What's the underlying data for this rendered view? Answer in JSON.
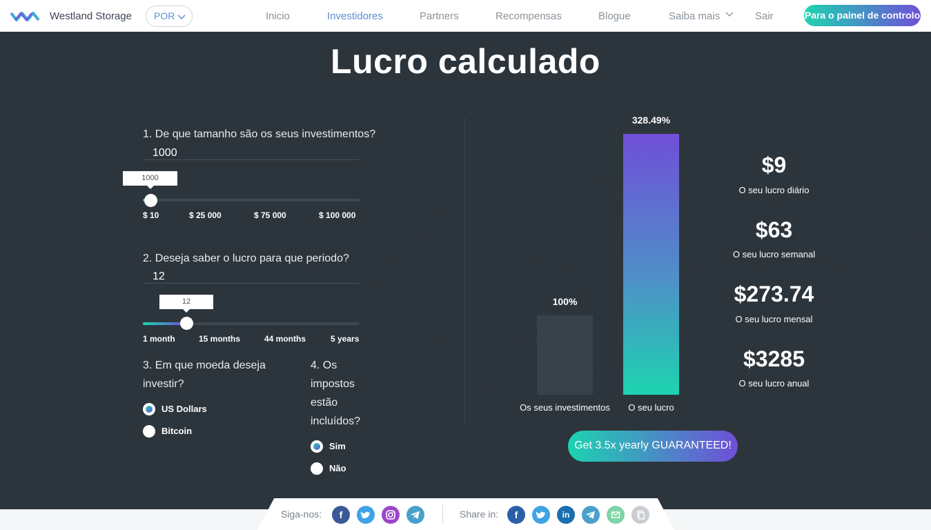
{
  "header": {
    "brand": "Westland Storage",
    "lang": "POR",
    "nav": [
      "Inicio",
      "Investidores",
      "Partners",
      "Recompensas",
      "Blogue",
      "Saiba mais",
      "Sair"
    ],
    "active_nav": "Investidores",
    "dashboard_button": "Para o painel de controlo"
  },
  "title": "Lucro calculado",
  "form": {
    "q1": "1. De que tamanho são os seus investimentos?",
    "amount_value": "1000",
    "amount_tooltip": "1000",
    "amount_slider_fraction": 0.0,
    "amount_ticks": [
      "$ 10",
      "$ 25 000",
      "$ 75 000",
      "$ 100 000"
    ],
    "q2": "2. Deseja saber o lucro para que periodo?",
    "period_value": "12",
    "period_tooltip": "12",
    "period_slider_fraction": 0.2,
    "period_ticks": [
      "1 month",
      "15 months",
      "44 months",
      "5 years"
    ],
    "q3": "3. Em que moeda deseja investir?",
    "currency_options": [
      "US Dollars",
      "Bitcoin"
    ],
    "currency_selected": "US Dollars",
    "q4": "4. Os impostos estão incluídos?",
    "tax_options": [
      "Sim",
      "Não"
    ],
    "tax_selected": "Sim"
  },
  "chart_data": {
    "type": "bar",
    "categories": [
      "Os seus investimentos",
      "O seu lucro"
    ],
    "values": [
      100,
      328.49
    ],
    "value_labels": [
      "100%",
      "328.49%"
    ]
  },
  "stats": [
    {
      "value": "$9",
      "label": "O seu lucro diário"
    },
    {
      "value": "$63",
      "label": "O seu lucro semanal"
    },
    {
      "value": "$273.74",
      "label": "O seu lucro mensal"
    },
    {
      "value": "$3285",
      "label": "O seu lucro anual"
    }
  ],
  "cta": "Get 3.5x yearly GUARANTEED!",
  "footer": {
    "follow_label": "Siga-nos:",
    "share_label": "Share in:",
    "follow_icons": [
      "facebook-icon",
      "twitter-icon",
      "instagram-icon",
      "telegram-icon"
    ],
    "share_icons": [
      "facebook-icon",
      "twitter-icon",
      "linkedin-icon",
      "telegram-icon",
      "email-icon",
      "copy-icon"
    ]
  },
  "colors": {
    "accent": "#5b8fd1",
    "gradient_start": "#1dd3b0",
    "gradient_end": "#6f4fd8",
    "background": "#2d353c"
  }
}
